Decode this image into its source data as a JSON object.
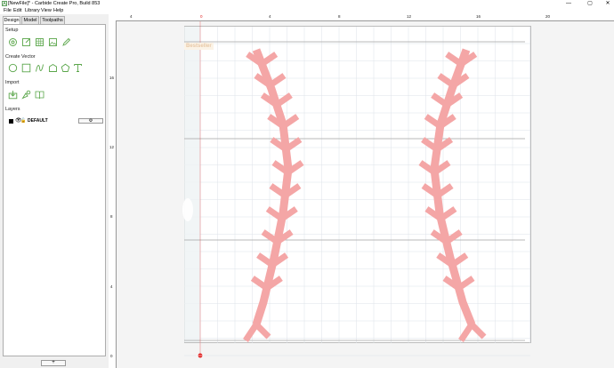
{
  "window": {
    "title": "[NewFile]* - Carbide Create Pro, Build 853",
    "minimize_glyph": "—",
    "maximize_glyph": "▢",
    "close_glyph": "✕"
  },
  "menu": [
    "File",
    "Edit",
    "Library",
    "View",
    "Help"
  ],
  "tabs": [
    "Design",
    "Model",
    "Toolpaths"
  ],
  "sections": {
    "setup": "Setup",
    "create_vector": "Create Vector",
    "import": "Import",
    "layers": "Layers"
  },
  "layers": [
    {
      "name": "DEFAULT",
      "color": "#000000"
    }
  ],
  "layer_settings_glyph": "⚙",
  "add_layer_glyph": "+",
  "ruler": {
    "top": [
      "4",
      "0",
      "4",
      "8",
      "12",
      "16",
      "20"
    ],
    "left": [
      "16",
      "12",
      "8",
      "4",
      "0"
    ]
  },
  "watermark": "Bestseller",
  "colors": {
    "accent_green": "#5aa64a",
    "stitch_red": "#f4a6a6",
    "origin_red": "#e02020"
  }
}
